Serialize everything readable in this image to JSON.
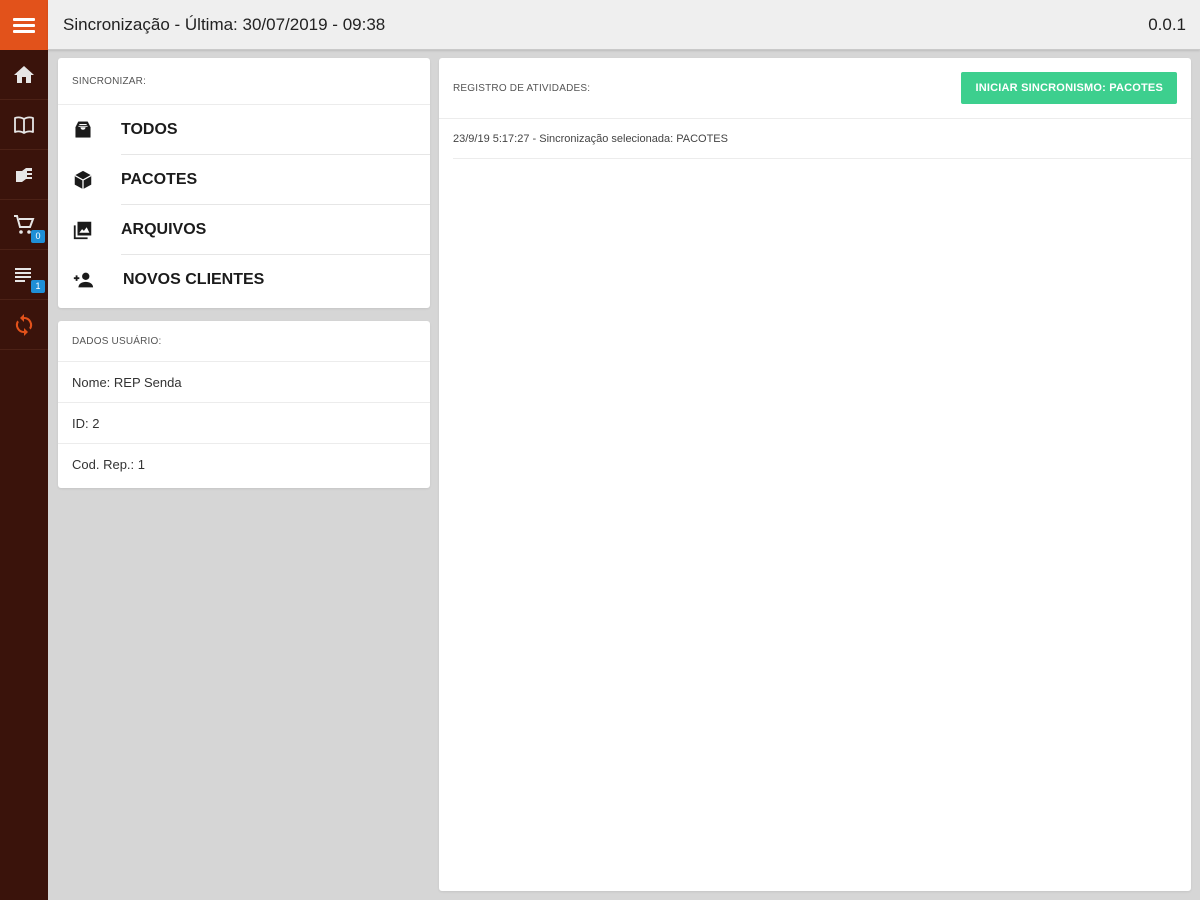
{
  "colors": {
    "sidebar": "#3a130b",
    "accent": "#e2521b",
    "badge": "#1f8fd6",
    "action": "#3dcf8e"
  },
  "sidebar": {
    "items": [
      {
        "icon": "home-icon"
      },
      {
        "icon": "book-icon"
      },
      {
        "icon": "catalog-icon"
      },
      {
        "icon": "cart-icon",
        "badge": "0"
      },
      {
        "icon": "list-icon",
        "badge": "1"
      },
      {
        "icon": "sync-icon",
        "active": true
      }
    ]
  },
  "header": {
    "title": "Sincronização - Última: 30/07/2019 - 09:38",
    "version": "0.0.1"
  },
  "sync": {
    "header": "SINCRONIZAR:",
    "items": [
      {
        "label": "TODOS",
        "icon": "inbox-icon"
      },
      {
        "label": "PACOTES",
        "icon": "package-icon"
      },
      {
        "label": "ARQUIVOS",
        "icon": "image-icon"
      },
      {
        "label": "NOVOS CLIENTES",
        "icon": "person-add-icon"
      }
    ]
  },
  "user": {
    "header": "DADOS USUÁRIO:",
    "rows": [
      "Nome: REP Senda",
      "ID: 2",
      "Cod. Rep.: 1"
    ]
  },
  "log": {
    "header": "REGISTRO DE ATIVIDADES:",
    "button_label": "INICIAR SINCRONISMO: PACOTES",
    "entries": [
      "23/9/19 5:17:27 - Sincronização selecionada: PACOTES"
    ]
  }
}
